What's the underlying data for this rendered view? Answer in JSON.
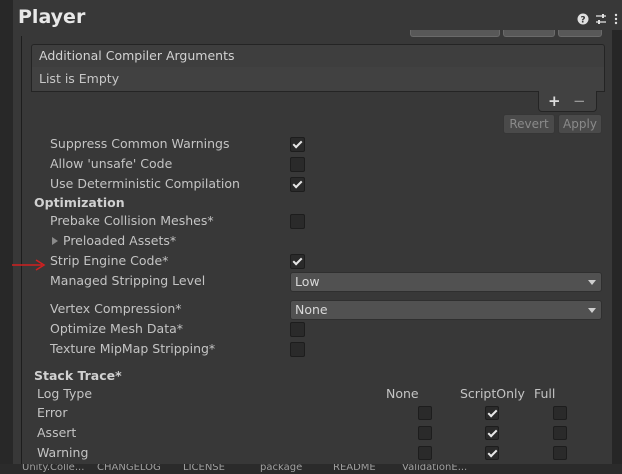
{
  "header": {
    "title": "Player",
    "icons": [
      "help-icon",
      "settings-sliders-icon",
      "more-menu-icon"
    ]
  },
  "compiler_args": {
    "header": "Additional Compiler Arguments",
    "empty_text": "List is Empty",
    "add_symbol": "+",
    "remove_symbol": "−",
    "revert_label": "Revert",
    "apply_label": "Apply"
  },
  "settings": {
    "suppress_warnings": {
      "label": "Suppress Common Warnings",
      "checked": true
    },
    "allow_unsafe": {
      "label": "Allow 'unsafe' Code",
      "checked": false
    },
    "deterministic": {
      "label": "Use Deterministic Compilation",
      "checked": true
    }
  },
  "optimization": {
    "section_title": "Optimization",
    "prebake": {
      "label": "Prebake Collision Meshes*",
      "checked": false
    },
    "preloaded_assets": {
      "label": "Preloaded Assets*"
    },
    "strip_engine_code": {
      "label": "Strip Engine Code*",
      "checked": true
    },
    "managed_stripping": {
      "label": "Managed Stripping Level",
      "value": "Low"
    },
    "vertex_compression": {
      "label": "Vertex Compression*",
      "value": "None"
    },
    "optimize_mesh": {
      "label": "Optimize Mesh Data*",
      "checked": false
    },
    "mipmap_stripping": {
      "label": "Texture MipMap Stripping*",
      "checked": false
    }
  },
  "stack_trace": {
    "section_title": "Stack Trace*",
    "columns": {
      "log_type": "Log Type",
      "none": "None",
      "script_only": "ScriptOnly",
      "full": "Full"
    },
    "rows": [
      {
        "label": "Error",
        "selected": "ScriptOnly"
      },
      {
        "label": "Assert",
        "selected": "ScriptOnly"
      },
      {
        "label": "Warning",
        "selected": "ScriptOnly"
      }
    ]
  },
  "bottom_bar": {
    "items": [
      "Unity.Colle...",
      "CHANGELOG",
      "LICENSE",
      "package",
      "README",
      "ValidationE..."
    ]
  },
  "colors": {
    "background": "#383838",
    "annotation_arrow": "#d02020"
  }
}
